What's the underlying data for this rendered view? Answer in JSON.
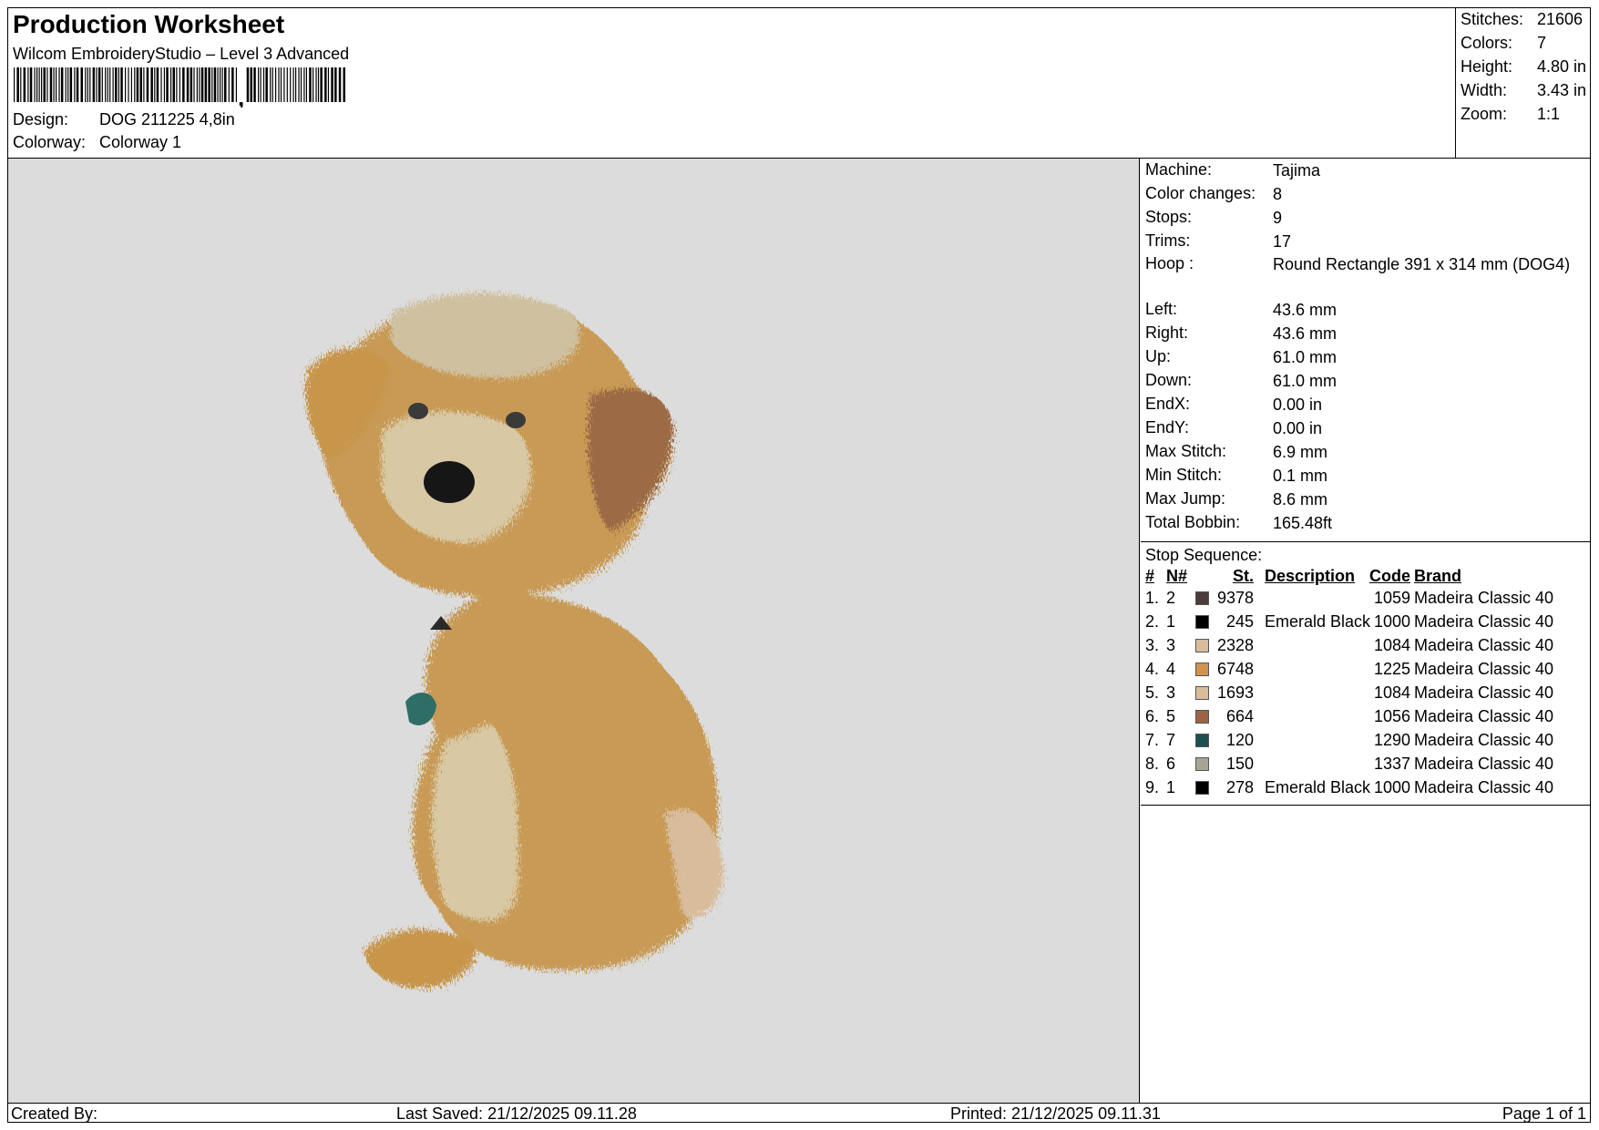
{
  "header": {
    "title": "Production Worksheet",
    "subtitle": "Wilcom EmbroideryStudio – Level 3 Advanced",
    "design_label": "Design:",
    "design_value": "DOG 211225 4,8in",
    "colorway_label": "Colorway:",
    "colorway_value": "Colorway 1"
  },
  "stats": [
    {
      "label": "Stitches:",
      "value": "21606"
    },
    {
      "label": "Colors:",
      "value": "7"
    },
    {
      "label": "Height:",
      "value": "4.80 in"
    },
    {
      "label": "Width:",
      "value": "3.43 in"
    },
    {
      "label": "Zoom:",
      "value": "1:1"
    }
  ],
  "info": [
    {
      "label": "Machine:",
      "value": "Tajima"
    },
    {
      "label": "Color changes:",
      "value": "8"
    },
    {
      "label": "Stops:",
      "value": "9"
    },
    {
      "label": "Trims:",
      "value": "17"
    },
    {
      "label": "Hoop :",
      "value": "Round Rectangle 391 x 314 mm (DOG4)"
    },
    {
      "label": "Left:",
      "value": "43.6 mm"
    },
    {
      "label": "Right:",
      "value": "43.6 mm"
    },
    {
      "label": "Up:",
      "value": "61.0 mm"
    },
    {
      "label": "Down:",
      "value": "61.0 mm"
    },
    {
      "label": "EndX:",
      "value": "0.00 in"
    },
    {
      "label": "EndY:",
      "value": "0.00 in"
    },
    {
      "label": "Max Stitch:",
      "value": "6.9 mm"
    },
    {
      "label": "Min Stitch:",
      "value": "0.1 mm"
    },
    {
      "label": "Max Jump:",
      "value": "8.6 mm"
    },
    {
      "label": "Total Bobbin:",
      "value": "165.48ft"
    }
  ],
  "stop_sequence": {
    "title": "Stop Sequence:",
    "headers": {
      "num": "#",
      "n": "N#",
      "st": "St.",
      "desc": "Description",
      "code": "Code",
      "brand": "Brand"
    },
    "rows": [
      {
        "num": "1.",
        "n": "2",
        "color": "#4a3c3a",
        "st": "9378",
        "desc": "",
        "code": "1059",
        "brand": "Madeira Classic 40"
      },
      {
        "num": "2.",
        "n": "1",
        "color": "#000000",
        "st": "245",
        "desc": "Emerald Black",
        "code": "1000",
        "brand": "Madeira Classic 40"
      },
      {
        "num": "3.",
        "n": "3",
        "color": "#d8bc9c",
        "st": "2328",
        "desc": "",
        "code": "1084",
        "brand": "Madeira Classic 40"
      },
      {
        "num": "4.",
        "n": "4",
        "color": "#d0944a",
        "st": "6748",
        "desc": "",
        "code": "1225",
        "brand": "Madeira Classic 40"
      },
      {
        "num": "5.",
        "n": "3",
        "color": "#d8bc9c",
        "st": "1693",
        "desc": "",
        "code": "1084",
        "brand": "Madeira Classic 40"
      },
      {
        "num": "6.",
        "n": "5",
        "color": "#9c6444",
        "st": "664",
        "desc": "",
        "code": "1056",
        "brand": "Madeira Classic 40"
      },
      {
        "num": "7.",
        "n": "7",
        "color": "#1c5050",
        "st": "120",
        "desc": "",
        "code": "1290",
        "brand": "Madeira Classic 40"
      },
      {
        "num": "8.",
        "n": "6",
        "color": "#a8a494",
        "st": "150",
        "desc": "",
        "code": "1337",
        "brand": "Madeira Classic 40"
      },
      {
        "num": "9.",
        "n": "1",
        "color": "#000000",
        "st": "278",
        "desc": "Emerald Black",
        "code": "1000",
        "brand": "Madeira Classic 40"
      }
    ]
  },
  "footer": {
    "created_by": "Created By:",
    "last_saved": "Last Saved: 21/12/2025 09.11.28",
    "printed": "Printed: 21/12/2025 09.11.31",
    "page": "Page 1 of 1"
  }
}
